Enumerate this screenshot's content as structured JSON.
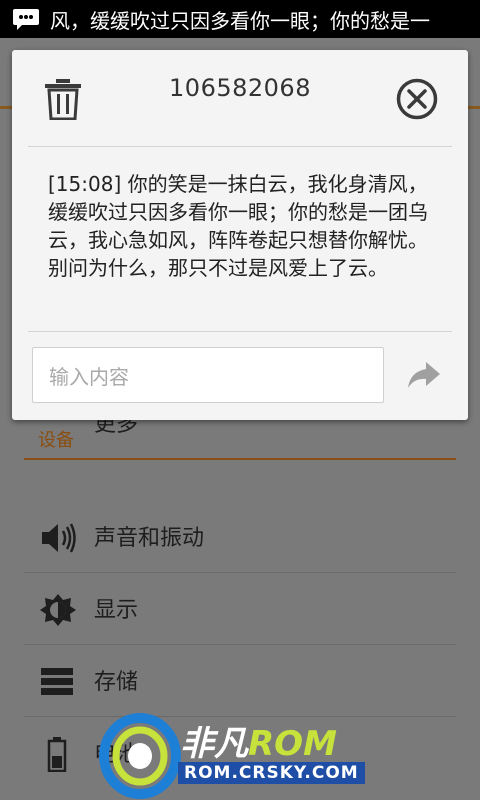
{
  "status_bar": {
    "notification_icon": "message-icon",
    "ticker_text": "风，缓缓吹过只因多看你一眼；你的愁是一"
  },
  "background_settings": {
    "partial_item_label": "更多",
    "section_title": "设备",
    "items": [
      {
        "label": "声音和振动",
        "icon": "speaker-icon"
      },
      {
        "label": "显示",
        "icon": "brightness-icon"
      },
      {
        "label": "存储",
        "icon": "storage-icon"
      },
      {
        "label": "电池",
        "icon": "battery-icon"
      }
    ]
  },
  "dialog": {
    "title": "106582068",
    "delete_icon": "trash-icon",
    "close_icon": "close-icon",
    "message": "[15:08] 你的笑是一抹白云，我化身清风，缓缓吹过只因多看你一眼；你的愁是一团乌云，我心急如风，阵阵卷起只想替你解忧。别问为什么，那只不过是风爱上了云。",
    "reply_placeholder": "输入内容",
    "send_icon": "send-icon"
  },
  "watermark": {
    "brand_cn": "非凡",
    "brand_rom": "ROM",
    "url": "ROM.CRSKY.COM"
  },
  "colors": {
    "accent": "#8a4f12",
    "dialog_bg": "#f4f4f4",
    "dim_overlay": "#7a7a7a"
  }
}
